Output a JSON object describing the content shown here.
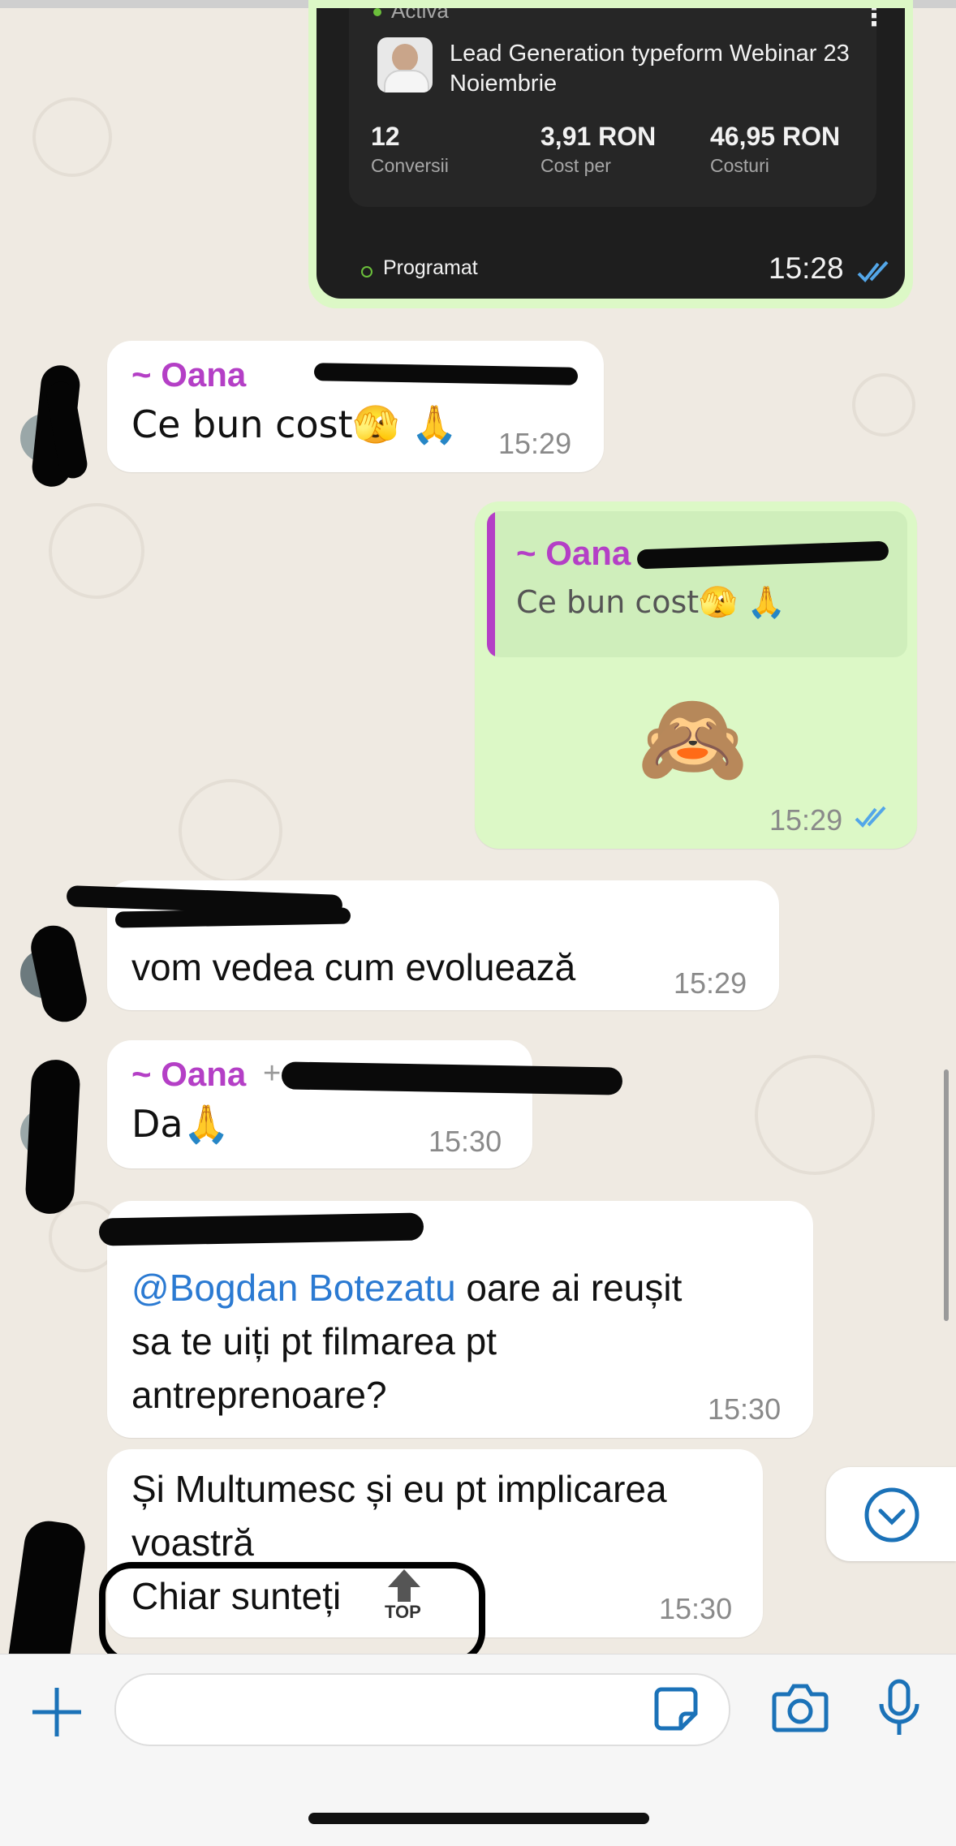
{
  "ad_card": {
    "status_active": "Activa",
    "campaign_title": "Lead Generation typeform Webinar 23 Noiembrie",
    "stats": [
      {
        "value": "12",
        "label": "Conversii"
      },
      {
        "value": "3,91 RON",
        "label": "Cost per"
      },
      {
        "value": "46,95 RON",
        "label": "Costuri"
      }
    ],
    "status_scheduled": "Programat",
    "time": "15:28"
  },
  "messages": [
    {
      "sender": "~ Oana",
      "text": "Ce bun cost🫣 🙏",
      "time": "15:29"
    },
    {
      "quote_sender": "~ Oana",
      "quote_text": "Ce bun cost🫣 🙏",
      "emoji": "🙈",
      "time": "15:29"
    },
    {
      "text": "vom vedea cum evoluează",
      "time": "15:29"
    },
    {
      "sender": "~ Oana",
      "sender_suffix": "+",
      "text": "Da🙏",
      "time": "15:30"
    },
    {
      "mention": "@Bogdan Botezatu",
      "text_after": " oare ai reușit",
      "line2": "sa te uiți pt filmarea pt",
      "line3": "antreprenoare?",
      "time": "15:30"
    },
    {
      "line1": "Și Multumesc și eu pt implicarea",
      "line2": "voastră",
      "line3": "Chiar sunteți",
      "time": "15:30"
    }
  ],
  "overlay": {
    "top_label": "TOP"
  },
  "colors": {
    "wallpaper": "#efeae2",
    "outgoing": "#dcf8c6",
    "sender": "#b43fc6",
    "mention": "#2b7ad2",
    "read_ticks": "#53a6e8"
  },
  "input_bar": {
    "icons": [
      "plus-icon",
      "sticker-icon",
      "camera-icon",
      "microphone-icon"
    ]
  }
}
